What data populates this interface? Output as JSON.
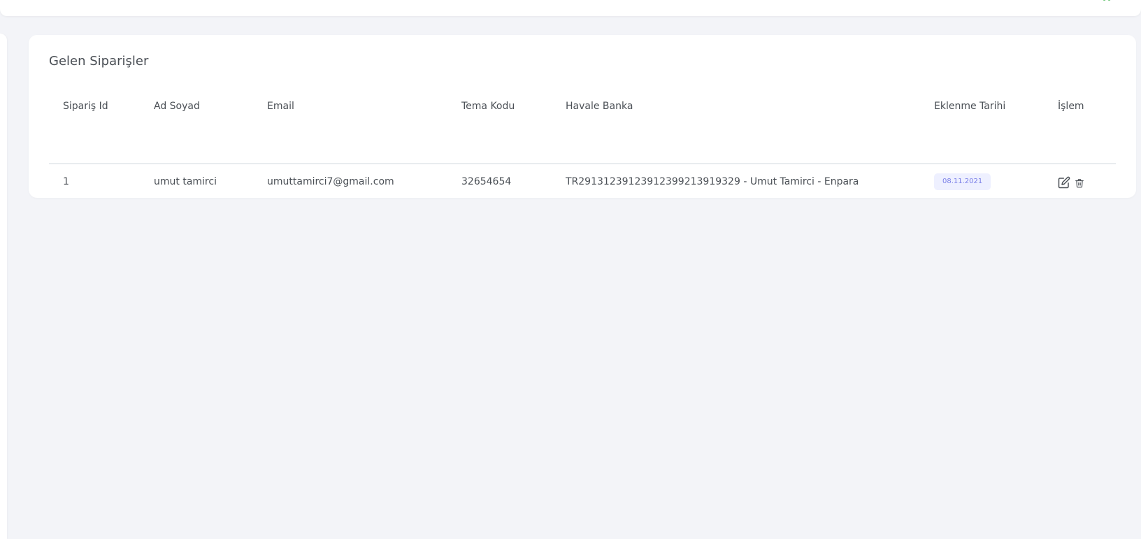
{
  "card": {
    "title": "Gelen Siparişler"
  },
  "table": {
    "columns": [
      "Sipariş Id",
      "Ad Soyad",
      "Email",
      "Tema Kodu",
      "Havale Banka",
      "Eklenme Tarihi",
      "İşlem"
    ],
    "rows": [
      {
        "id": "1",
        "name": "umut tamirci",
        "email": "umuttamirci7@gmail.com",
        "theme_code": "32654654",
        "bank": "TR29131239123912399213919329 - Umut Tamirci - Enpara",
        "date": "08.11.2021"
      }
    ]
  },
  "icons": {
    "edit": "edit-icon",
    "delete": "trash-icon",
    "topbar": "status-icon"
  },
  "colors": {
    "badge_bg": "#eef0ff",
    "badge_text": "#7a7fe8",
    "topbar_icon": "#3cb34a"
  }
}
